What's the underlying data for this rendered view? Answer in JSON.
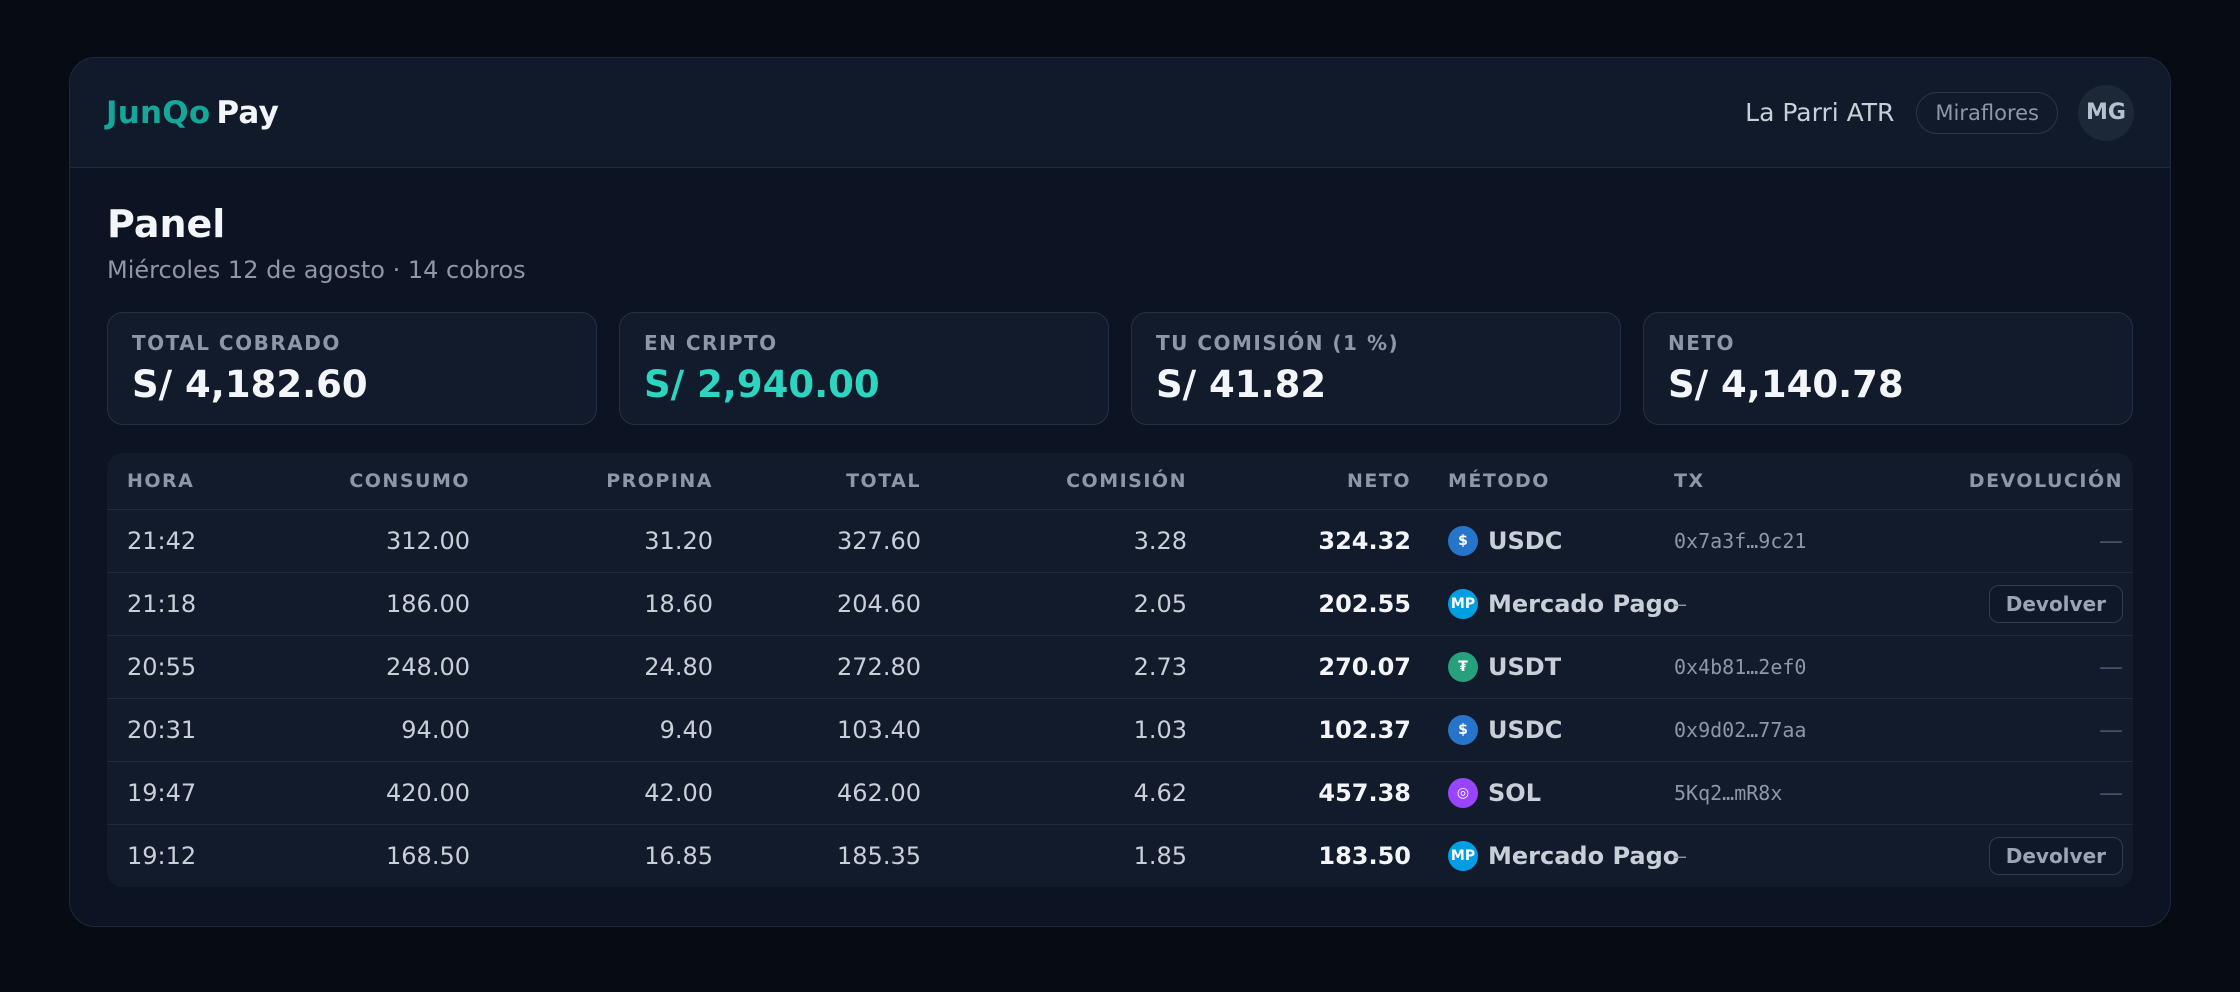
{
  "header": {
    "brand_first": "JunQo",
    "brand_second": "Pay",
    "venue": "La Parri ATR",
    "location": "Miraflores",
    "avatar_initials": "MG"
  },
  "page": {
    "title": "Panel",
    "subtitle": "Miércoles 12 de agosto · 14 cobros"
  },
  "stats": [
    {
      "label": "TOTAL COBRADO",
      "value": "S/ 4,182.60"
    },
    {
      "label": "EN CRIPTO",
      "value": "S/ 2,940.00"
    },
    {
      "label": "TU COMISIÓN (1 %)",
      "value": "S/ 41.82"
    },
    {
      "label": "NETO",
      "value": "S/ 4,140.78"
    }
  ],
  "table": {
    "columns": [
      "HORA",
      "CONSUMO",
      "PROPINA",
      "TOTAL",
      "COMISIÓN",
      "NETO",
      "MÉTODO",
      "TX",
      "DEVOLUCIÓN"
    ],
    "rows": [
      {
        "hora": "21:42",
        "consumo": "312.00",
        "propina": "31.20",
        "total": "327.60",
        "comision": "3.28",
        "neto": "324.32",
        "metodo": "USDC",
        "icon_glyph": "$",
        "tx": "0x7a3f…9c21",
        "devolucion": "—"
      },
      {
        "hora": "21:18",
        "consumo": "186.00",
        "propina": "18.60",
        "total": "204.60",
        "comision": "2.05",
        "neto": "202.55",
        "metodo": "Mercado Pago",
        "icon_glyph": "MP",
        "tx": "–",
        "devolucion": "Devolver"
      },
      {
        "hora": "20:55",
        "consumo": "248.00",
        "propina": "24.80",
        "total": "272.80",
        "comision": "2.73",
        "neto": "270.07",
        "metodo": "USDT",
        "icon_glyph": "₮",
        "tx": "0x4b81…2ef0",
        "devolucion": "—"
      },
      {
        "hora": "20:31",
        "consumo": "94.00",
        "propina": "9.40",
        "total": "103.40",
        "comision": "1.03",
        "neto": "102.37",
        "metodo": "USDC",
        "icon_glyph": "$",
        "tx": "0x9d02…77aa",
        "devolucion": "—"
      },
      {
        "hora": "19:47",
        "consumo": "420.00",
        "propina": "42.00",
        "total": "462.00",
        "comision": "4.62",
        "neto": "457.38",
        "metodo": "SOL",
        "icon_glyph": "◎",
        "tx": "5Kq2…mR8x",
        "devolucion": "—"
      },
      {
        "hora": "19:12",
        "consumo": "168.50",
        "propina": "16.85",
        "total": "185.35",
        "comision": "1.85",
        "neto": "183.50",
        "metodo": "Mercado Pago",
        "icon_glyph": "MP",
        "tx": "–",
        "devolucion": "Devolver"
      }
    ]
  },
  "colors": {
    "accent": "#2dd4bf",
    "brand": "#14a89a",
    "usdc": "#2775ca",
    "usdt": "#26a17b",
    "sol": "#9945ff",
    "mercado_pago": "#009ee3"
  }
}
